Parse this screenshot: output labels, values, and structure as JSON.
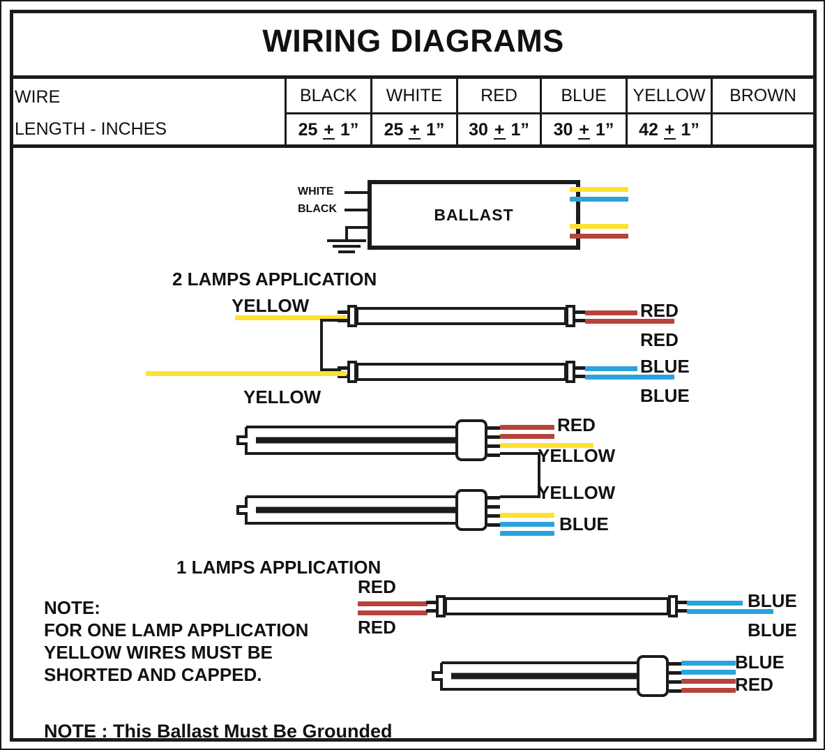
{
  "page": {
    "title": "WIRING DIAGRAMS"
  },
  "wire_table": {
    "row_label_line1": "WIRE",
    "row_label_line2": "LENGTH - INCHES",
    "columns": [
      "BLACK",
      "WHITE",
      "RED",
      "BLUE",
      "YELLOW",
      "BROWN"
    ],
    "lengths": [
      "25 + 1”",
      "25 + 1”",
      "30 + 1”",
      "30 + 1”",
      "42 + 1”",
      ""
    ],
    "lengths_parts": [
      {
        "num": "25",
        "pm": "+",
        "tol": "1”"
      },
      {
        "num": "25",
        "pm": "+",
        "tol": "1”"
      },
      {
        "num": "30",
        "pm": "+",
        "tol": "1”"
      },
      {
        "num": "30",
        "pm": "+",
        "tol": "1”"
      },
      {
        "num": "42",
        "pm": "+",
        "tol": "1”"
      },
      {
        "num": "",
        "pm": "",
        "tol": ""
      }
    ]
  },
  "ballast": {
    "label": "BALLAST",
    "input_white": "WHITE",
    "input_black": "BLACK",
    "output_wires": [
      "yellow",
      "blue",
      "yellow",
      "red"
    ]
  },
  "sections": {
    "two_lamps_heading": "2 LAMPS APPLICATION",
    "one_lamp_heading": "1 LAMPS APPLICATION"
  },
  "two_lamp_linear": {
    "left_top": "YELLOW",
    "left_bottom": "YELLOW",
    "right_lamp1_top": "RED",
    "right_lamp1_bottom": "RED",
    "right_lamp2_top": "BLUE",
    "right_lamp2_bottom": "BLUE"
  },
  "two_lamp_cfl": {
    "upper_label_1": "RED",
    "upper_label_2": "YELLOW",
    "lower_label_1": "YELLOW",
    "lower_label_2": "BLUE"
  },
  "one_lamp_linear": {
    "left_top": "RED",
    "left_bottom": "RED",
    "right_top": "BLUE",
    "right_bottom": "BLUE"
  },
  "one_lamp_cfl": {
    "label_blue": "BLUE",
    "label_red": "RED"
  },
  "notes": {
    "note_heading": "NOTE:",
    "note_line1": "FOR ONE LAMP APPLICATION",
    "note_line2": "YELLOW WIRES MUST BE",
    "note_line3": "SHORTED AND CAPPED.",
    "ground_note": "NOTE : This Ballast Must Be Grounded"
  },
  "colors": {
    "yellow": "#FFE033",
    "blue": "#29A3DC",
    "red": "#B8433A",
    "black": "#1b1b1b",
    "paper": "#ffffff"
  }
}
